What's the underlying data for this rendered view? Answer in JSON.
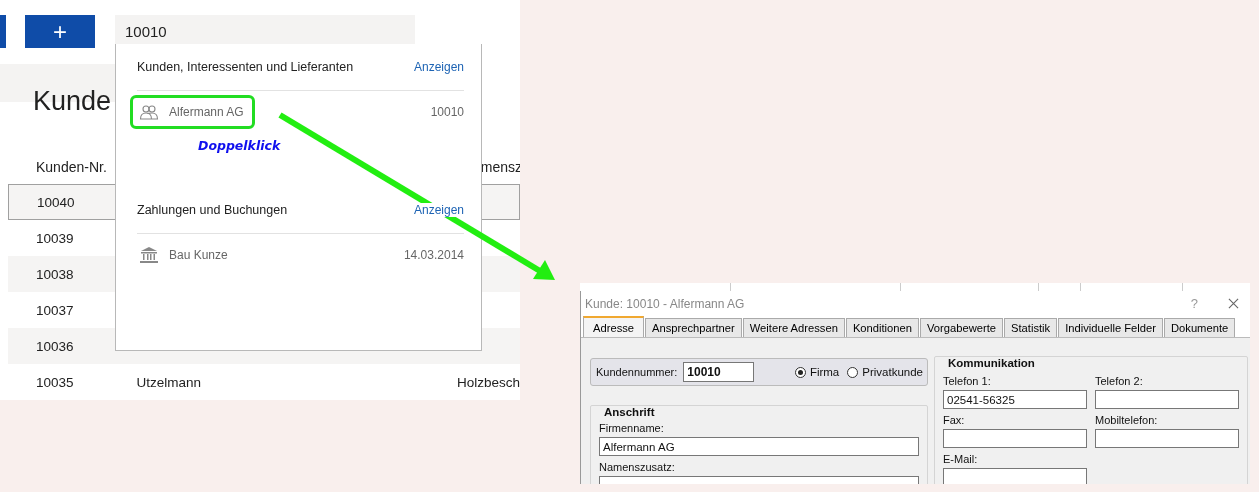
{
  "toolbar": {
    "add_button": "+",
    "search": {
      "value": "10010"
    }
  },
  "page_title": "Kunde",
  "table": {
    "columns": {
      "number": "Kunden-Nr.",
      "column_3": "mensz"
    },
    "rows": [
      {
        "number": "10040",
        "selected": true
      },
      {
        "number": "10039",
        "selected": false
      },
      {
        "number": "10038",
        "selected": false
      },
      {
        "number": "10037",
        "selected": false
      },
      {
        "number": "10036",
        "selected": false
      },
      {
        "number": "10035",
        "name": "Utzelmann",
        "column_3": "Holzbesch",
        "selected": false
      }
    ]
  },
  "dropdown": {
    "sections": [
      {
        "title": "Kunden, Interessenten und Lieferanten",
        "link": "Anzeigen",
        "items": [
          {
            "kind": "person",
            "label": "Alfermann AG",
            "value": "10010",
            "highlighted": true
          }
        ]
      },
      {
        "title": "Zahlungen und Buchungen",
        "link": "Anzeigen",
        "items": [
          {
            "kind": "bank",
            "label": "Bau Kunze",
            "value": "14.03.2014",
            "highlighted": false
          }
        ]
      }
    ]
  },
  "annotation": {
    "text": "Doppelklick"
  },
  "dialog": {
    "title": "Kunde: 10010 - Alfermann AG",
    "help": "?",
    "tabs": [
      {
        "label": "Adresse",
        "selected": true
      },
      {
        "label": "Ansprechpartner",
        "selected": false
      },
      {
        "label": "Weitere Adressen",
        "selected": false
      },
      {
        "label": "Konditionen",
        "selected": false
      },
      {
        "label": "Vorgabewerte",
        "selected": false
      },
      {
        "label": "Statistik",
        "selected": false
      },
      {
        "label": "Individuelle Felder",
        "selected": false
      },
      {
        "label": "Dokumente",
        "selected": false
      }
    ],
    "customer_number": {
      "label": "Kundennummer:",
      "value": "10010"
    },
    "customer_type": [
      {
        "label": "Firma",
        "selected": true
      },
      {
        "label": "Privatkunde",
        "selected": false
      }
    ],
    "anschrift": {
      "title": "Anschrift",
      "fields": [
        {
          "label": "Firmenname:",
          "value": "Alfermann AG"
        },
        {
          "label": "Namenszusatz:"
        }
      ]
    },
    "kommunikation": {
      "title": "Kommunikation",
      "fields": [
        {
          "label": "Telefon 1:",
          "value": "02541-56325"
        },
        {
          "label": "Telefon 2:"
        },
        {
          "label": "Fax:"
        },
        {
          "label": "Mobiltelefon:"
        },
        {
          "label": "E-Mail:"
        }
      ]
    }
  }
}
